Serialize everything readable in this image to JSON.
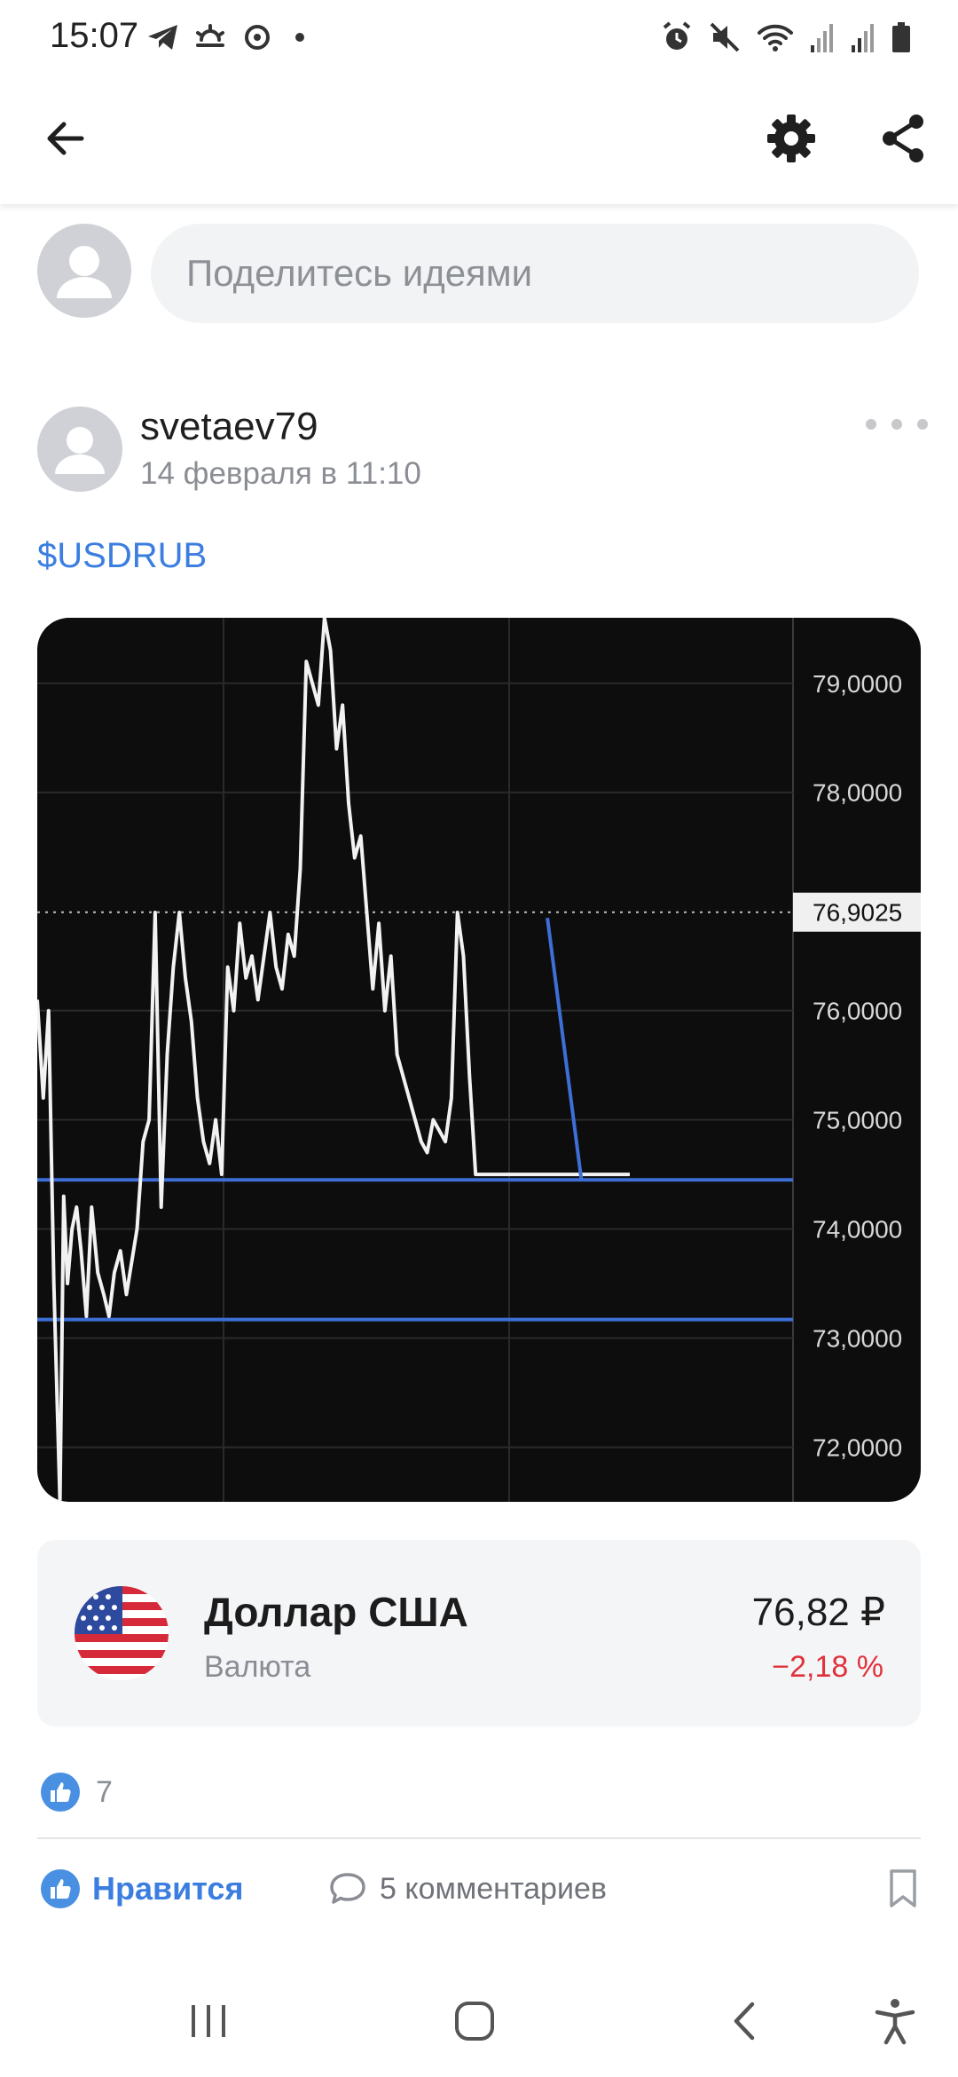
{
  "status_bar": {
    "time": "15:07",
    "left_icons": [
      "telegram-icon",
      "weather-icon",
      "app-icon",
      "dot"
    ],
    "right_icons": [
      "alarm-icon",
      "mute-icon",
      "wifi-icon",
      "signal-icon",
      "signal-icon",
      "battery-icon"
    ]
  },
  "header": {
    "back_icon": "arrow-back",
    "settings_icon": "gear",
    "share_icon": "share"
  },
  "composer": {
    "placeholder": "Поделитесь идеями"
  },
  "post": {
    "author": "svetaev79",
    "date": "14 февраля в 11:10",
    "ticker": "$USDRUB",
    "more_icon": "more-horizontal"
  },
  "chart_data": {
    "type": "line",
    "title": "",
    "xlabel": "",
    "ylabel": "",
    "ylim": [
      71.5,
      79.6
    ],
    "y_ticks": [
      "79,0000",
      "78,0000",
      "76,0000",
      "75,0000",
      "74,0000",
      "73,0000",
      "72,0000"
    ],
    "y_tick_values": [
      79,
      78,
      76,
      75,
      74,
      73,
      72
    ],
    "current_price_label": "76,9025",
    "current_price": 76.9025,
    "series": [
      {
        "color": "#f2f2f2",
        "x": [
          0,
          0.8,
          1.5,
          2.2,
          3,
          3.5,
          4,
          4.6,
          5.2,
          5.8,
          6.5,
          7.2,
          8,
          8.8,
          9.5,
          10.2,
          11,
          11.8,
          12.5,
          13.2,
          14,
          14.8,
          15.6,
          16.4,
          17.2,
          18,
          18.8,
          19.6,
          20.4,
          21.2,
          22,
          22.8,
          23.6,
          24.4,
          25.2,
          26,
          26.8,
          27.6,
          28.4,
          29.2,
          30,
          30.8,
          31.6,
          32.4,
          33.2,
          34,
          34.8,
          35.6,
          36.4,
          37.2,
          38,
          38.8,
          39.6,
          40.4,
          41.2,
          42,
          42.8,
          43.6,
          44.4,
          45.2,
          46,
          46.8,
          47.6,
          48.4,
          49.2,
          50,
          50.8,
          51.6,
          52.4,
          53.2,
          54,
          54.8,
          55.6,
          56.4,
          57.2,
          58,
          58.8,
          59.6,
          60.4,
          61.2,
          62,
          62.8,
          63.6,
          64.4,
          65.2,
          66,
          66.8,
          67.6,
          68.4,
          69.2,
          70,
          70.8,
          71.6,
          72.4,
          73.2,
          74,
          74.8,
          75.6,
          76.4,
          77.2,
          78,
          78.4
        ],
        "values": [
          76.1,
          75.2,
          76.0,
          73.5,
          71.5,
          74.3,
          73.5,
          74.0,
          74.2,
          73.8,
          73.2,
          74.2,
          73.6,
          73.4,
          73.2,
          73.6,
          73.8,
          73.4,
          73.7,
          74.0,
          74.8,
          75.0,
          76.9,
          74.2,
          75.6,
          76.4,
          76.9,
          76.3,
          75.9,
          75.2,
          74.8,
          74.6,
          75.0,
          74.5,
          76.4,
          76.0,
          76.8,
          76.3,
          76.5,
          76.1,
          76.5,
          76.9,
          76.4,
          76.2,
          76.7,
          76.5,
          77.3,
          79.2,
          79.0,
          78.8,
          79.6,
          79.3,
          78.4,
          78.8,
          77.9,
          77.4,
          77.6,
          76.9,
          76.2,
          76.8,
          76.0,
          76.5,
          75.6,
          75.4,
          75.2,
          75.0,
          74.8,
          74.7,
          75.0,
          74.9,
          74.8,
          75.2,
          76.9,
          76.5,
          75.4,
          74.5,
          74.5,
          74.5,
          74.5,
          74.5,
          74.5,
          74.5,
          74.5,
          74.5,
          74.5,
          74.5,
          74.5,
          74.5,
          74.5,
          74.5,
          74.5,
          74.5,
          74.5,
          74.5,
          74.5,
          74.5,
          74.5,
          74.5,
          74.5,
          74.5,
          74.5,
          74.5
        ]
      }
    ],
    "horizontal_lines": [
      74.45,
      73.17
    ],
    "trend_line": {
      "from": [
        67.5,
        76.85
      ],
      "to": [
        72.0,
        74.45
      ]
    },
    "grid": true,
    "colors": {
      "background": "#0d0d0d",
      "price_line": "#f2f2f2",
      "drawings": "#3d6fd6",
      "grid": "#2a2a2a"
    }
  },
  "instrument_card": {
    "name": "Доллар США",
    "type": "Валюта",
    "price": "76,82 ₽",
    "change": "−2,18 %",
    "flag_icon": "us-flag"
  },
  "reactions": {
    "likes_count": "7",
    "like_label": "Нравится",
    "comments_label": "5 комментариев",
    "bookmark_icon": "bookmark"
  },
  "nav_bar": {
    "recent_icon": "recent-apps",
    "home_icon": "home",
    "back_icon": "back",
    "accessibility_icon": "accessibility"
  },
  "colors": {
    "accent": "#3b7ee0",
    "negative": "#e0323b"
  }
}
